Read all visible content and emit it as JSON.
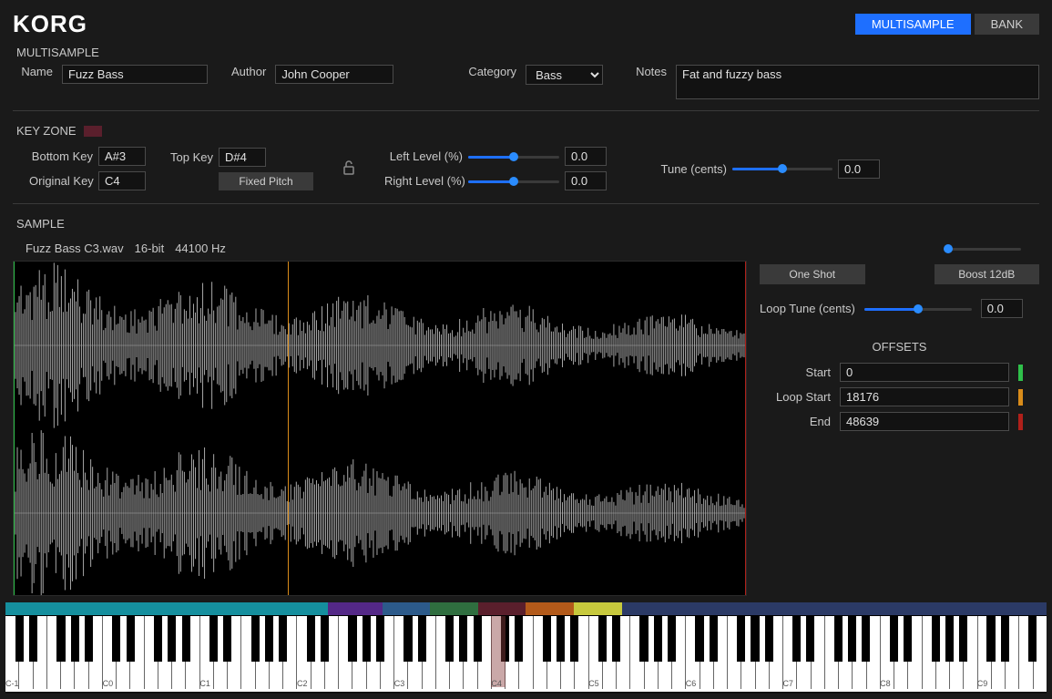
{
  "header": {
    "logo": "KORG",
    "multisample_btn": "MULTISAMPLE",
    "bank_btn": "BANK"
  },
  "multisample": {
    "section_label": "MULTISAMPLE",
    "name_label": "Name",
    "name_value": "Fuzz Bass",
    "author_label": "Author",
    "author_value": "John Cooper",
    "category_label": "Category",
    "category_value": "Bass",
    "notes_label": "Notes",
    "notes_value": "Fat and fuzzy bass"
  },
  "keyzone": {
    "section_label": "KEY ZONE",
    "bottom_key_label": "Bottom Key",
    "bottom_key_value": "A#3",
    "top_key_label": "Top Key",
    "top_key_value": "D#4",
    "original_key_label": "Original Key",
    "original_key_value": "C4",
    "fixed_pitch_label": "Fixed Pitch",
    "left_level_label": "Left Level (%)",
    "left_level_value": "0.0",
    "right_level_label": "Right Level (%)",
    "right_level_value": "0.0",
    "tune_label": "Tune (cents)",
    "tune_value": "0.0",
    "color": "#5a1f2c"
  },
  "sample": {
    "section_label": "SAMPLE",
    "filename": "Fuzz Bass C3.wav",
    "bit_depth": "16-bit",
    "sample_rate": "44100 Hz",
    "one_shot_label": "One Shot",
    "boost_label": "Boost 12dB",
    "loop_tune_label": "Loop Tune (cents)",
    "loop_tune_value": "0.0",
    "offsets_label": "OFFSETS",
    "start_label": "Start",
    "start_value": "0",
    "loop_start_label": "Loop Start",
    "loop_start_value": "18176",
    "end_label": "End",
    "end_value": "48639",
    "start_color": "#2fc04a",
    "loop_start_color": "#d98c1a",
    "end_color": "#b0201a"
  },
  "keyboard": {
    "octaves": [
      "C-1",
      "C0",
      "C1",
      "C2",
      "C3",
      "C4",
      "C5",
      "C6",
      "C7",
      "C8",
      "C9"
    ],
    "selected_key": "C4",
    "zones": [
      {
        "width": 31.0,
        "color": "#158f9e"
      },
      {
        "width": 5.2,
        "color": "#542887"
      },
      {
        "width": 4.6,
        "color": "#2c5a8a"
      },
      {
        "width": 4.6,
        "color": "#2f6e3f"
      },
      {
        "width": 4.6,
        "color": "#5a1f2c"
      },
      {
        "width": 4.6,
        "color": "#b35a1a"
      },
      {
        "width": 4.6,
        "color": "#c7c93d"
      },
      {
        "width": 40.8,
        "color": "#2b3a66"
      }
    ]
  }
}
